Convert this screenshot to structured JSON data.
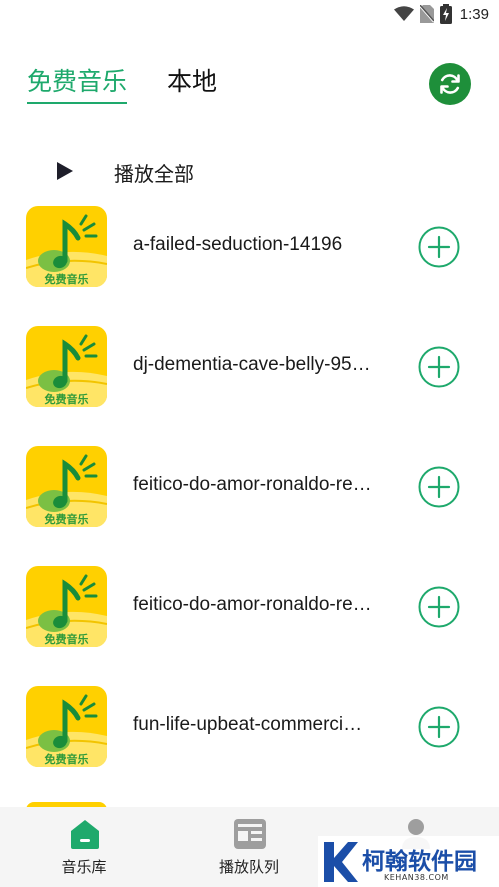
{
  "status_bar": {
    "time": "1:39",
    "icons": [
      "wifi-icon",
      "no-sim-icon",
      "battery-charging-icon"
    ]
  },
  "tabs": [
    {
      "label": "免费音乐",
      "active": true
    },
    {
      "label": "本地",
      "active": false
    }
  ],
  "refresh": {
    "icon": "refresh-icon",
    "color": "#1e8f3a"
  },
  "play_all": {
    "label": "播放全部",
    "icon": "play-icon"
  },
  "songs": [
    {
      "title": "a-failed-seduction-14196",
      "cover_caption": "免费音乐"
    },
    {
      "title": "dj-dementia-cave-belly-95…",
      "cover_caption": "免费音乐"
    },
    {
      "title": "feitico-do-amor-ronaldo-re…",
      "cover_caption": "免费音乐"
    },
    {
      "title": "feitico-do-amor-ronaldo-re…",
      "cover_caption": "免费音乐"
    },
    {
      "title": "fun-life-upbeat-commerci…",
      "cover_caption": "免费音乐"
    }
  ],
  "bottom_nav": [
    {
      "label": "音乐库",
      "icon": "home-icon",
      "active": true
    },
    {
      "label": "播放队列",
      "icon": "queue-icon",
      "active": false
    },
    {
      "label": "",
      "icon": "profile-icon",
      "active": false
    }
  ],
  "watermark": {
    "title": "柯翰软件园",
    "subtitle": "KEHAN38.COM"
  },
  "colors": {
    "accent": "#1ea96c",
    "dark_green": "#1e8f3a",
    "cover_yellow": "#ffd000"
  }
}
